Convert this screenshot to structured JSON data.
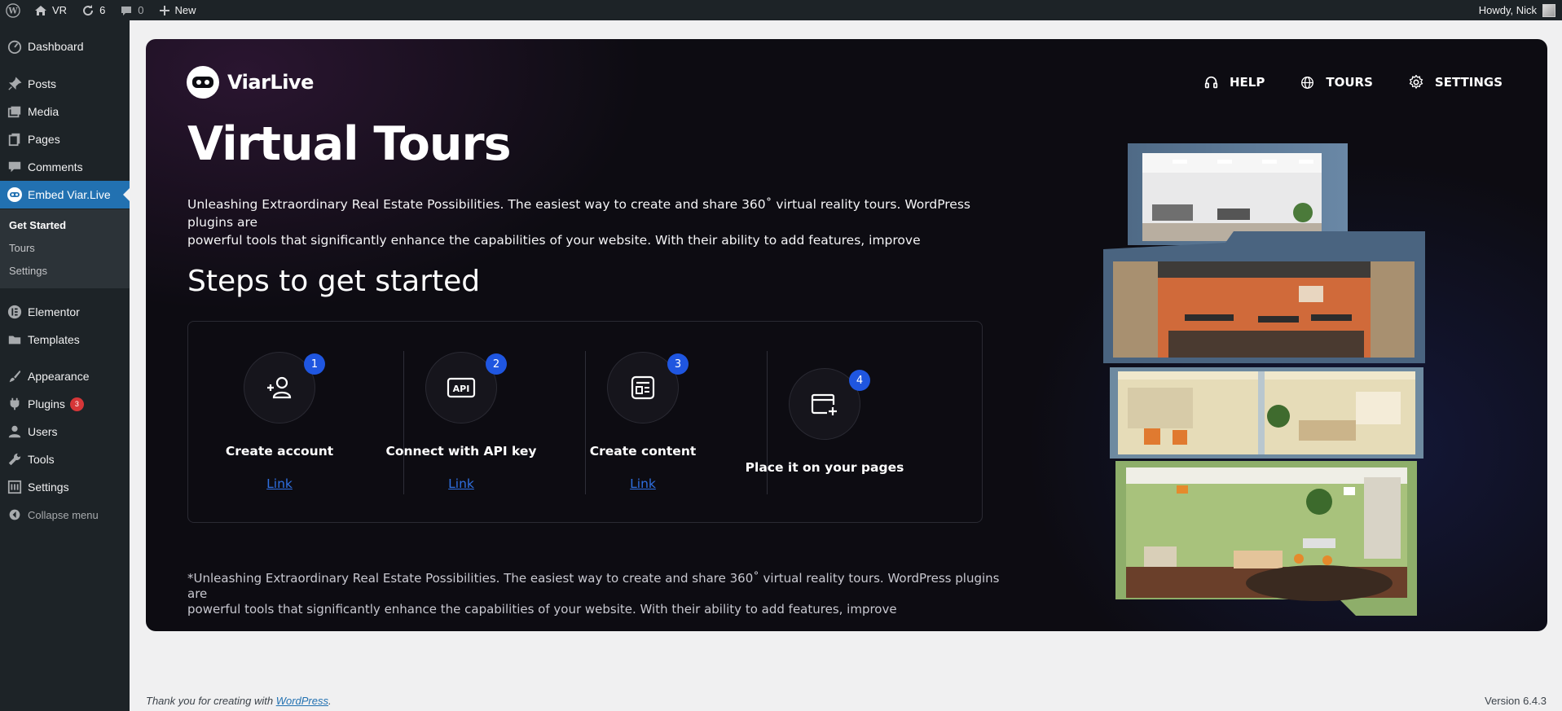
{
  "admin_bar": {
    "site_name": "VR",
    "updates_count": "6",
    "comments_count": "0",
    "new_label": "New",
    "greeting": "Howdy, Nick"
  },
  "sidebar": {
    "items": [
      {
        "label": "Dashboard",
        "icon": "dashboard-icon"
      },
      {
        "label": "Posts",
        "icon": "pin-icon"
      },
      {
        "label": "Media",
        "icon": "media-icon"
      },
      {
        "label": "Pages",
        "icon": "pages-icon"
      },
      {
        "label": "Comments",
        "icon": "comment-icon"
      },
      {
        "label": "Embed Viar.Live",
        "icon": "viarlive-icon"
      },
      {
        "label": "Elementor",
        "icon": "elementor-icon"
      },
      {
        "label": "Templates",
        "icon": "folder-icon"
      },
      {
        "label": "Appearance",
        "icon": "brush-icon"
      },
      {
        "label": "Plugins",
        "icon": "plug-icon",
        "badge": "3"
      },
      {
        "label": "Users",
        "icon": "user-icon"
      },
      {
        "label": "Tools",
        "icon": "wrench-icon"
      },
      {
        "label": "Settings",
        "icon": "settings-icon"
      }
    ],
    "submenu": [
      "Get Started",
      "Tours",
      "Settings"
    ],
    "collapse_label": "Collapse menu"
  },
  "card": {
    "brand": "ViarLive",
    "nav": [
      "HELP",
      "TOURS",
      "SETTINGS"
    ],
    "title": "Virtual Tours",
    "intro_line1": "Unleashing Extraordinary Real Estate Possibilities. The easiest way to create and share 360˚ virtual reality tours. WordPress plugins are",
    "intro_line2": "powerful tools that significantly enhance the capabilities of your website. With their ability to add features, improve",
    "steps_title": "Steps to get started",
    "steps": [
      {
        "number": "1",
        "title": "Create account",
        "link": "Link",
        "icon": "add-user-icon"
      },
      {
        "number": "2",
        "title": "Connect with API key",
        "link": "Link",
        "icon": "api-icon"
      },
      {
        "number": "3",
        "title": "Create content",
        "link": "Link",
        "icon": "content-icon"
      },
      {
        "number": "4",
        "title": "Place it on your pages",
        "icon": "add-window-icon"
      }
    ],
    "footnote_line1": "*Unleashing Extraordinary Real Estate Possibilities. The easiest way to create and share 360˚ virtual reality tours. WordPress plugins are",
    "footnote_line2": "powerful tools that significantly enhance the capabilities of your website. With their ability to add features, improve"
  },
  "footer": {
    "thanks_prefix": "Thank you for creating with ",
    "thanks_link": "WordPress",
    "thanks_suffix": ".",
    "version": "Version 6.4.3"
  },
  "colors": {
    "accent": "#2271b1",
    "badge_blue": "#1f56e0",
    "sidebar_bg": "#1d2327"
  }
}
